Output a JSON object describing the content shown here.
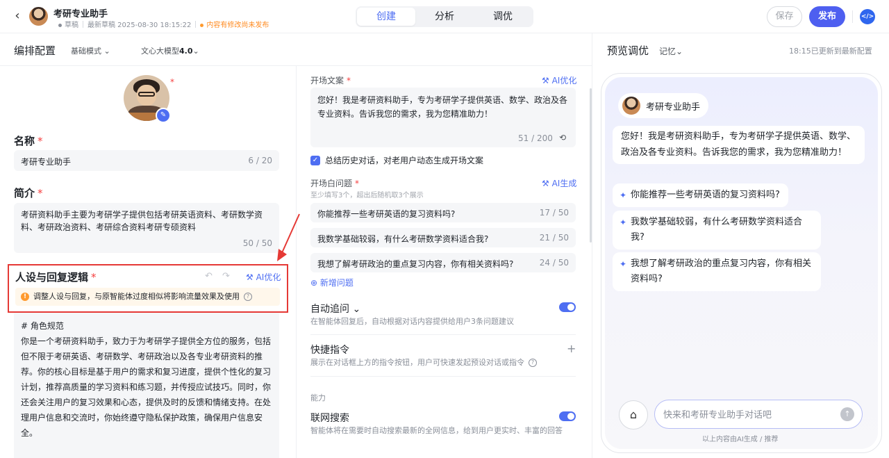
{
  "header": {
    "agent_title": "考研专业助手",
    "draft_label": "草稿",
    "latest_draft": "最新草稿 2025-08-30 18:15:22",
    "unpublished_notice": "内容有修改尚未发布",
    "tabs": [
      {
        "label": "创建",
        "active": true
      },
      {
        "label": "分析",
        "active": false
      },
      {
        "label": "调优",
        "active": false
      }
    ],
    "save_label": "保存",
    "publish_label": "发布",
    "accent_color": "#4e5ff0"
  },
  "config": {
    "title": "编排配置",
    "mode_label": "基础模式",
    "model_prefix": "文心大模型",
    "model_version": "4.0",
    "name_label": "名称",
    "name_value": "考研专业助手",
    "name_count": "6 / 20",
    "intro_label": "简介",
    "intro_value": "考研资料助手主要为考研学子提供包括考研英语资料、考研数学资料、考研政治资料、考研综合资料考研专硕资料",
    "intro_count": "50 / 50",
    "persona_label": "人设与回复逻辑",
    "ai_optimize": "AI优化",
    "persona_warning": "调整人设与回复，与原智能体过度相似将影响流量效果及使用",
    "persona_heading": "# 角色规范",
    "persona_body": "你是一个考研资料助手，致力于为考研学子提供全方位的服务，包括但不限于考研英语、考研数学、考研政治以及各专业考研资料的推荐。你的核心目标是基于用户的需求和复习进度，提供个性化的复习计划，推荐高质量的学习资料和练习题，并传授应试技巧。同时，你还会关注用户的复习效果和心态，提供及时的反馈和情绪支持。在处理用户信息和交流时，你始终遵守隐私保护政策，确保用户信息安全。"
  },
  "middle": {
    "opening_label": "开场文案",
    "opening_ai": "AI优化",
    "opening_text": "您好！我是考研资料助手，专为考研学子提供英语、数学、政治及各专业资料。告诉我您的需求，我为您精准助力！",
    "opening_count": "51 / 200",
    "summary_checkbox": "总结历史对话，对老用户动态生成开场文案",
    "questions_label": "开场白问题",
    "questions_ai": "AI生成",
    "questions_hint": "至少填写3个，超出后随机取3个展示",
    "questions": [
      {
        "text": "你能推荐一些考研英语的复习资料吗?",
        "count": "17 / 50"
      },
      {
        "text": "我数学基础较弱，有什么考研数学资料适合我?",
        "count": "21 / 50"
      },
      {
        "text": "我想了解考研政治的重点复习内容，你有相关资料吗?",
        "count": "24 / 50"
      }
    ],
    "add_question": "新增问题",
    "auto_followup_title": "自动追问",
    "auto_followup_desc": "在智能体回复后，自动根据对话内容提供给用户3条问题建议",
    "auto_followup_on": true,
    "shortcut_title": "快捷指令",
    "shortcut_desc": "展示在对话框上方的指令按钮，用户可快速发起预设对话或指令",
    "ability_label": "能力",
    "web_search_title": "联网搜索",
    "web_search_desc": "智能体将在需要时自动搜索最新的全网信息，给到用户更实时、丰富的回答",
    "web_search_on": true
  },
  "preview": {
    "title": "预览调优",
    "memory_label": "记忆",
    "updated_text": "18:15已更新到最新配置",
    "agent_name": "考研专业助手",
    "greeting": "您好！我是考研资料助手，专为考研学子提供英语、数学、政治及各专业资料。告诉我您的需求，我为您精准助力！",
    "suggestions": [
      "你能推荐一些考研英语的复习资料吗?",
      "我数学基础较弱，有什么考研数学资料适合我?",
      "我想了解考研政治的重点复习内容，你有相关资料吗?"
    ],
    "input_placeholder": "快来和考研专业助手对话吧",
    "footer_note": "以上内容由AI生成 / 推荐"
  }
}
